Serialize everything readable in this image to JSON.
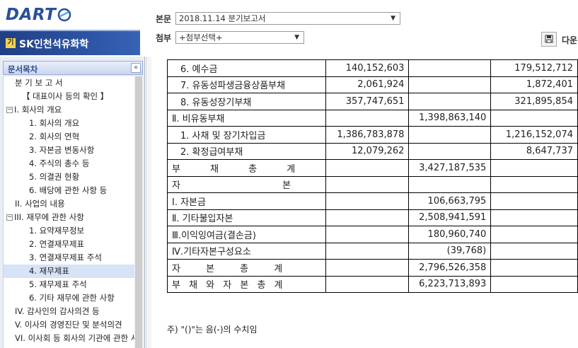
{
  "header": {
    "logo_text": "DART",
    "company_tag": "기",
    "company_name": "SK인천석유화학",
    "report_label": "본문",
    "report_value": "2018.11.14  분기보고서",
    "attach_label": "첨부",
    "attach_value": "+첨부선택+",
    "download_label": "다운"
  },
  "sidebar": {
    "title": "문서목차",
    "collapse_glyph": "«",
    "items": [
      {
        "label": "분 기 보 고 서",
        "toggle": ""
      },
      {
        "label": "【 대표이사 등의 확인 】",
        "toggle": ""
      },
      {
        "label": "I. 회사의 개요",
        "toggle": "−"
      },
      {
        "label": "1. 회사의 개요",
        "toggle": ""
      },
      {
        "label": "2. 회사의 연혁",
        "toggle": ""
      },
      {
        "label": "3. 자본금 변동사항",
        "toggle": ""
      },
      {
        "label": "4. 주식의 총수 등",
        "toggle": ""
      },
      {
        "label": "5. 의결권 현황",
        "toggle": ""
      },
      {
        "label": "6. 배당에 관한 사항 등",
        "toggle": ""
      },
      {
        "label": "II. 사업의 내용",
        "toggle": ""
      },
      {
        "label": "III. 재무에 관한 사항",
        "toggle": "−"
      },
      {
        "label": "1. 요약재무정보",
        "toggle": ""
      },
      {
        "label": "2. 연결재무제표",
        "toggle": ""
      },
      {
        "label": "3. 연결재무제표 주석",
        "toggle": ""
      },
      {
        "label": "4. 재무제표",
        "toggle": ""
      },
      {
        "label": "5. 재무제표 주석",
        "toggle": ""
      },
      {
        "label": "6. 기타 재무에 관한 사항",
        "toggle": ""
      },
      {
        "label": "IV. 감사인의 감사의견 등",
        "toggle": ""
      },
      {
        "label": "V. 이사의 경영진단 및 분석의견",
        "toggle": ""
      },
      {
        "label": "VI. 이사회 등 회사의 기관에 관한 사항",
        "toggle": ""
      }
    ]
  },
  "table": {
    "rows": [
      {
        "name": "6. 예수금",
        "v1": "140,152,603",
        "v2": "",
        "v3": "179,512,712"
      },
      {
        "name": "7. 유동성파생금융상품부채",
        "v1": "2,061,924",
        "v2": "",
        "v3": "1,872,401"
      },
      {
        "name": "8. 유동성장기부채",
        "v1": "357,747,651",
        "v2": "",
        "v3": "321,895,854"
      },
      {
        "name": "Ⅱ. 비유동부채",
        "v1": "",
        "v2": "1,398,863,140",
        "v3": ""
      },
      {
        "name": "1. 사채 및 장기차입금",
        "v1": "1,386,783,878",
        "v2": "",
        "v3": "1,216,152,074"
      },
      {
        "name": "2. 확정급여부채",
        "v1": "12,079,262",
        "v2": "",
        "v3": "8,647,737"
      },
      {
        "name": "부 채 총 계",
        "v1": "",
        "v2": "3,427,187,535",
        "v3": ""
      },
      {
        "name": "자 본",
        "v1": "",
        "v2": "",
        "v3": ""
      },
      {
        "name": "Ⅰ. 자본금",
        "v1": "",
        "v2": "106,663,795",
        "v3": ""
      },
      {
        "name": "Ⅱ. 기타불입자본",
        "v1": "",
        "v2": "2,508,941,591",
        "v3": ""
      },
      {
        "name": "Ⅲ.이익잉여금(결손금)",
        "v1": "",
        "v2": "180,960,740",
        "v3": ""
      },
      {
        "name": "Ⅳ.기타자본구성요소",
        "v1": "",
        "v2": "(39,768)",
        "v3": ""
      },
      {
        "name": "자 본 총 계",
        "v1": "",
        "v2": "2,796,526,358",
        "v3": ""
      },
      {
        "name": "부 채 와 자 본 총 계",
        "v1": "",
        "v2": "6,223,713,893",
        "v3": ""
      }
    ]
  },
  "note": "주) \"()\"는 음(-)의 수치임"
}
